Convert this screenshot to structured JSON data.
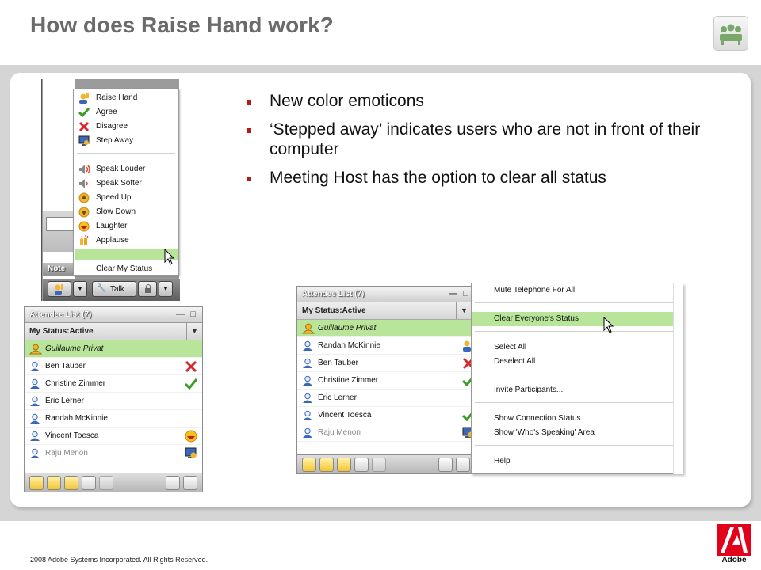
{
  "slide": {
    "title": "How does Raise Hand work?",
    "footer": "2008 Adobe Systems Incorporated. All Rights Reserved.",
    "logo_text": "Adobe"
  },
  "bullets": [
    "New color emoticons",
    "‘Stepped away’ indicates users who are not in front of their computer",
    "Meeting Host has the option to clear all status"
  ],
  "status_menu": {
    "items": [
      {
        "label": "Raise Hand",
        "icon": "raise-hand-icon"
      },
      {
        "label": "Agree",
        "icon": "agree-check-icon"
      },
      {
        "label": "Disagree",
        "icon": "disagree-x-icon"
      },
      {
        "label": "Step Away",
        "icon": "step-away-icon"
      },
      {
        "label": "Speak Louder",
        "icon": "speak-louder-icon"
      },
      {
        "label": "Speak Softer",
        "icon": "speak-softer-icon"
      },
      {
        "label": "Speed Up",
        "icon": "speed-up-icon"
      },
      {
        "label": "Slow Down",
        "icon": "slow-down-icon"
      },
      {
        "label": "Laughter",
        "icon": "laughter-icon"
      },
      {
        "label": "Applause",
        "icon": "applause-icon"
      }
    ],
    "clear_label": "Clear My Status",
    "note_label": "Note",
    "talk_label": "Talk"
  },
  "attendee_left": {
    "title": "Attendee List (7)",
    "status": "My Status:Active",
    "attendees": [
      {
        "name": "Guillaume Privat",
        "status_icon": ""
      },
      {
        "name": "Ben Tauber",
        "status_icon": "disagree-x-icon"
      },
      {
        "name": "Christine Zimmer",
        "status_icon": "agree-check-icon"
      },
      {
        "name": "Eric Lerner",
        "status_icon": ""
      },
      {
        "name": "Randah McKinnie",
        "status_icon": ""
      },
      {
        "name": "Vincent Toesca",
        "status_icon": "laughter-icon"
      },
      {
        "name": "Raju Menon",
        "status_icon": "step-away-icon"
      }
    ]
  },
  "attendee_right": {
    "title": "Attendee List (7)",
    "status": "My Status:Active",
    "attendees": [
      {
        "name": "Guillaume Privat",
        "status_icon": ""
      },
      {
        "name": "Randah McKinnie",
        "status_icon": "raise-hand-icon"
      },
      {
        "name": "Ben Tauber",
        "status_icon": "disagree-x-icon"
      },
      {
        "name": "Christine Zimmer",
        "status_icon": "agree-check-icon"
      },
      {
        "name": "Eric Lerner",
        "status_icon": ""
      },
      {
        "name": "Vincent Toesca",
        "status_icon": "agree-check-icon"
      },
      {
        "name": "Raju Menon",
        "status_icon": "step-away-icon"
      }
    ]
  },
  "context_menu": {
    "items": [
      "Mute Telephone For All",
      "Clear Everyone's Status",
      "Select All",
      "Deselect All",
      "Invite Participants...",
      "Show Connection Status",
      "Show 'Who's Speaking' Area",
      "Help"
    ]
  },
  "colors": {
    "highlight": "#b8e59a",
    "title_gray": "#6b6b6b",
    "bullet_red": "#b31b1b",
    "adobe_red": "#e3001b"
  }
}
